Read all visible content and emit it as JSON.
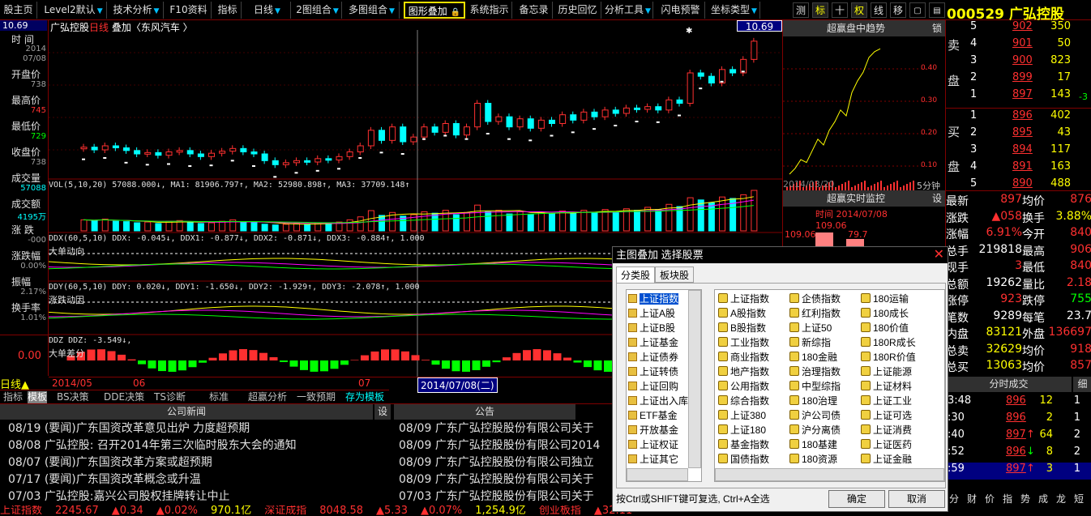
{
  "menu": {
    "items": [
      {
        "label": "股主页",
        "arrow": false
      },
      {
        "label": "Level2默认",
        "arrow": true
      },
      {
        "label": "技术分析",
        "arrow": true
      },
      {
        "label": "F10资料",
        "arrow": false
      },
      {
        "label": "指标",
        "arrow": false
      },
      {
        "label": "日线",
        "arrow": true
      },
      {
        "label": "2图组合",
        "arrow": true
      },
      {
        "label": "多图组合",
        "arrow": true
      },
      {
        "label": "图形叠加",
        "arrow": false
      },
      {
        "label": "系统指示",
        "arrow": false
      },
      {
        "label": "备忘录",
        "arrow": false
      },
      {
        "label": "历史回忆",
        "arrow": false
      },
      {
        "label": "分析工具",
        "arrow": true
      },
      {
        "label": "闪电预警",
        "arrow": false
      },
      {
        "label": "坐标类型",
        "arrow": true
      }
    ],
    "lock_icon": "lock-icon",
    "tools": [
      "测",
      "标",
      "十",
      "权",
      "线",
      "移"
    ],
    "stock_title": "000529 广弘控股"
  },
  "left_panel": {
    "price_top": "10.69",
    "time_label": "时 间",
    "time_value_1": "2014",
    "time_value_2": "07/08",
    "rows": [
      {
        "label": "开盘价",
        "value": "738"
      },
      {
        "label": "最高价",
        "value": "745"
      },
      {
        "label": "最低价",
        "value": "729"
      },
      {
        "label": "收盘价",
        "value": "738"
      },
      {
        "label": "成交量",
        "value": "57088"
      },
      {
        "label": "成交额",
        "value": "4195万"
      },
      {
        "label": "涨 跌",
        "value": "-000"
      },
      {
        "label": "涨跌幅",
        "value": "0.00%"
      },
      {
        "label": "振幅",
        "value": "2.17%"
      },
      {
        "label": "换手率",
        "value": "1.01%"
      }
    ],
    "ddz_value": "0.00",
    "period": "日线"
  },
  "chart": {
    "title_left": "广弘控股",
    "title_period": "日线",
    "title_overlay": "叠加〈东风汽车 〉",
    "price_right": "10.69",
    "vol_header": "VOL(5,10,20)  57088.000↓, MA1: 81906.797↑, MA2: 52980.898↑, MA3: 37709.148↑",
    "ddx_header": "DDX(60,5,10)  DDX: -0.045↓, DDX1: -0.877↓, DDX2: -0.871↓, DDX3: -0.884↑, 1.000",
    "ddx_label": "大单动向",
    "ddy_header": "DDY(60,5,10)  DDY: 0.020↓, DDY1: -1.650↓, DDY2: -1.929↑, DDY3: -2.078↑, 1.000",
    "ddy_label": "涨跌动因",
    "ddz_header": "DDZ  DDZ: -3.549↓,",
    "ddz_label": "大单差分",
    "date_axis": [
      "2014/05",
      "06",
      "07"
    ],
    "cursor_date": "2014/07/08(二)"
  },
  "chart_data": {
    "type": "candlestick",
    "title": "",
    "candles": [
      {
        "o": 7.38,
        "c": 7.4
      },
      {
        "o": 7.4,
        "c": 7.36
      },
      {
        "o": 7.36,
        "c": 7.42
      },
      {
        "o": 7.42,
        "c": 7.39
      },
      {
        "o": 7.39,
        "c": 7.35
      },
      {
        "o": 7.35,
        "c": 7.3
      },
      {
        "o": 7.3,
        "c": 7.32
      },
      {
        "o": 7.32,
        "c": 7.28
      },
      {
        "o": 7.28,
        "c": 7.33
      },
      {
        "o": 7.33,
        "c": 7.35
      },
      {
        "o": 7.35,
        "c": 7.3
      },
      {
        "o": 7.3,
        "c": 7.26
      },
      {
        "o": 7.26,
        "c": 7.31
      },
      {
        "o": 7.31,
        "c": 7.34
      },
      {
        "o": 7.34,
        "c": 7.38
      },
      {
        "o": 7.38,
        "c": 7.33
      },
      {
        "o": 7.33,
        "c": 7.3
      },
      {
        "o": 7.3,
        "c": 7.2
      },
      {
        "o": 7.2,
        "c": 7.14
      },
      {
        "o": 7.14,
        "c": 7.17
      },
      {
        "o": 7.17,
        "c": 7.2
      },
      {
        "o": 7.2,
        "c": 7.18
      },
      {
        "o": 7.18,
        "c": 7.23
      },
      {
        "o": 7.23,
        "c": 7.21
      },
      {
        "o": 7.21,
        "c": 7.26
      },
      {
        "o": 7.26,
        "c": 7.33
      },
      {
        "o": 7.33,
        "c": 7.42
      },
      {
        "o": 7.42,
        "c": 7.65
      },
      {
        "o": 7.65,
        "c": 7.5
      },
      {
        "o": 7.5,
        "c": 7.7
      },
      {
        "o": 7.7,
        "c": 7.48
      },
      {
        "o": 7.48,
        "c": 7.55
      },
      {
        "o": 7.55,
        "c": 7.7
      },
      {
        "o": 7.7,
        "c": 7.62
      },
      {
        "o": 7.62,
        "c": 7.75
      },
      {
        "o": 7.75,
        "c": 7.58
      },
      {
        "o": 7.58,
        "c": 7.7
      },
      {
        "o": 7.7,
        "c": 8.05
      },
      {
        "o": 8.05,
        "c": 7.78
      },
      {
        "o": 7.78,
        "c": 7.85
      },
      {
        "o": 7.85,
        "c": 7.7
      },
      {
        "o": 7.7,
        "c": 7.82
      },
      {
        "o": 7.82,
        "c": 7.68
      },
      {
        "o": 7.68,
        "c": 7.8
      },
      {
        "o": 7.8,
        "c": 7.75
      },
      {
        "o": 7.75,
        "c": 7.88
      },
      {
        "o": 7.88,
        "c": 7.8
      },
      {
        "o": 7.8,
        "c": 7.92
      },
      {
        "o": 7.92,
        "c": 7.85
      },
      {
        "o": 7.85,
        "c": 7.95
      },
      {
        "o": 7.95,
        "c": 7.9
      },
      {
        "o": 7.9,
        "c": 7.98
      },
      {
        "o": 7.98,
        "c": 7.96
      },
      {
        "o": 7.96,
        "c": 8.0
      },
      {
        "o": 8.0,
        "c": 7.95
      },
      {
        "o": 7.95,
        "c": 8.1
      },
      {
        "o": 8.1,
        "c": 8.05
      },
      {
        "o": 8.05,
        "c": 8.5
      },
      {
        "o": 8.5,
        "c": 8.45
      },
      {
        "o": 8.45,
        "c": 8.35
      },
      {
        "o": 8.35,
        "c": 8.55
      },
      {
        "o": 8.55,
        "c": 8.5
      },
      {
        "o": 8.5,
        "c": 8.7
      },
      {
        "o": 8.7,
        "c": 8.97
      }
    ],
    "volume": [
      30,
      28,
      32,
      26,
      25,
      22,
      24,
      20,
      26,
      28,
      24,
      20,
      22,
      26,
      30,
      24,
      22,
      18,
      16,
      18,
      20,
      18,
      22,
      20,
      24,
      30,
      38,
      55,
      42,
      50,
      40,
      44,
      52,
      48,
      56,
      44,
      50,
      70,
      52,
      56,
      46,
      52,
      44,
      50,
      46,
      54,
      48,
      56,
      50,
      58,
      52,
      60,
      56,
      64,
      58,
      72,
      66,
      90,
      84,
      76,
      92,
      88,
      98,
      110
    ],
    "intraday_series": [
      0.0,
      0.02,
      0.05,
      0.04,
      0.08,
      0.12,
      0.1,
      0.15,
      0.18,
      0.22,
      0.2,
      0.28,
      0.32,
      0.35,
      0.4,
      0.42,
      0.43
    ],
    "monitor_bars": [
      {
        "time": "109.06",
        "color": "#ff8080"
      },
      {
        "time": "79.7",
        "color": "#ff8080"
      }
    ]
  },
  "mini": {
    "trend_title": "超赢盘中趋势",
    "lock": "锁",
    "trend_date": "2014/03/20",
    "trend_period": "5分钟",
    "trend_axis": [
      "0.40",
      "0.30",
      "0.20",
      "0.10"
    ],
    "monitor_title": "超赢实时监控",
    "monitor_set": "设",
    "monitor_time": "时间  2014/07/08",
    "monitor_v1": "109.06",
    "monitor_v2": "79.7",
    "monitor_left": "109.06"
  },
  "orderbook": {
    "sell_label_1": "卖",
    "sell_label_2": "盘",
    "buy_label_1": "买",
    "buy_label_2": "盘",
    "rows": [
      {
        "n": "5",
        "p": "902",
        "v": "350"
      },
      {
        "n": "4",
        "p": "901",
        "v": "50"
      },
      {
        "n": "3",
        "p": "900",
        "v": "823"
      },
      {
        "n": "2",
        "p": "899",
        "v": "17"
      },
      {
        "n": "1",
        "p": "897",
        "v": "143"
      },
      {
        "n": "1",
        "p": "896",
        "v": "402"
      },
      {
        "n": "2",
        "p": "895",
        "v": "43"
      },
      {
        "n": "3",
        "p": "894",
        "v": "117"
      },
      {
        "n": "4",
        "p": "891",
        "v": "163"
      },
      {
        "n": "5",
        "p": "890",
        "v": "488"
      }
    ],
    "side_value": "-3"
  },
  "stats": {
    "rows": [
      {
        "l": "最新",
        "v": "897",
        "l2": "均价",
        "v2": "876"
      },
      {
        "l": "涨跌",
        "v": "▲058",
        "l2": "换手",
        "v2": "3.88%"
      },
      {
        "l": "涨幅",
        "v": "6.91%",
        "l2": "今开",
        "v2": "840"
      },
      {
        "l": "总手",
        "v": "219818",
        "l2": "最高",
        "v2": "906"
      },
      {
        "l": "现手",
        "v": "3",
        "l2": "最低",
        "v2": "840"
      },
      {
        "l": "总额",
        "v": "19262",
        "l2": "量比",
        "v2": "2.18"
      },
      {
        "l": "涨停",
        "v": "923",
        "l2": "跌停",
        "v2": "755"
      },
      {
        "l": "笔数",
        "v": "9289",
        "l2": "每笔",
        "v2": "23.7"
      },
      {
        "l": "内盘",
        "v": "83121",
        "l2": "外盘",
        "v2": "136697"
      },
      {
        "l": "总卖",
        "v": "32629",
        "l2": "均价",
        "v2": "918"
      },
      {
        "l": "总买",
        "v": "13063",
        "l2": "均价",
        "v2": "857"
      }
    ]
  },
  "fenshi": {
    "title": "分时成交",
    "tab": "细",
    "rows": [
      {
        "t": "3:48",
        "p": "896",
        "arrow": "",
        "v": "12",
        "n": "1"
      },
      {
        "t": ":30",
        "p": "896",
        "arrow": "",
        "v": "2",
        "n": "1"
      },
      {
        "t": ":40",
        "p": "897",
        "arrow": "↑",
        "v": "64",
        "n": "2"
      },
      {
        "t": ":52",
        "p": "896",
        "arrow": "↓",
        "v": "8",
        "n": "2"
      },
      {
        "t": ":59",
        "p": "897",
        "arrow": "↑",
        "v": "3",
        "n": "1"
      }
    ],
    "bottom_tabs": [
      "分",
      "财",
      "价",
      "指",
      "势",
      "成",
      "龙",
      "短"
    ]
  },
  "tabs": {
    "items": [
      "指标",
      "模板",
      "BS决策",
      "DDE决策",
      "TS诊断",
      "标准",
      "超赢分析",
      "一致预期",
      "存为模板"
    ]
  },
  "news": {
    "left_title": "公司新闻",
    "right_title": "公告",
    "set": "设",
    "left": [
      {
        "date": "08/19",
        "text": "(要闻)广东国资改革意见出炉 力度超预期"
      },
      {
        "date": "08/08",
        "text": "广弘控股: 召开2014年第三次临时股东大会的通知"
      },
      {
        "date": "08/07",
        "text": "(要闻)广东国资改革方案或超预期"
      },
      {
        "date": "07/17",
        "text": "(要闻)广东国资改革概念或升温"
      },
      {
        "date": "07/03",
        "text": "广弘控股:嘉兴公司股权挂牌转让中止"
      }
    ],
    "right": [
      {
        "date": "08/09",
        "text": "广东广弘控股股份有限公司关于"
      },
      {
        "date": "08/09",
        "text": "广东广弘控股股份有限公司2014"
      },
      {
        "date": "08/09",
        "text": "广东广弘控股股份有限公司独立"
      },
      {
        "date": "08/09",
        "text": "广东广弘控股股份有限公司关于"
      },
      {
        "date": "07/03",
        "text": "广东广弘控股股份有限公司关于"
      }
    ]
  },
  "ticker": {
    "items": [
      {
        "text": "上证指数",
        "color": "#ff3030"
      },
      {
        "text": "2245.67",
        "color": "#ff3030"
      },
      {
        "text": "▲0.34",
        "color": "#ff3030"
      },
      {
        "text": "▲0.02%",
        "color": "#ff3030"
      },
      {
        "text": "970.1亿",
        "color": "#ffff00"
      },
      {
        "text": "深证成指",
        "color": "#ff3030"
      },
      {
        "text": "8048.58",
        "color": "#ff3030"
      },
      {
        "text": "▲5.33",
        "color": "#ff3030"
      },
      {
        "text": "▲0.07%",
        "color": "#ff3030"
      },
      {
        "text": "1,254.9亿",
        "color": "#ffff00"
      },
      {
        "text": "创业板指",
        "color": "#ff3030"
      },
      {
        "text": "▲32.11",
        "color": "#ff3030"
      }
    ]
  },
  "dialog": {
    "title": "主图叠加  选择股票",
    "tab1": "分类股",
    "tab2": "板块股",
    "tree": [
      "上证指数",
      "上证A股",
      "上证B股",
      "上证基金",
      "上证债券",
      "上证转债",
      "上证回购",
      "上证出入库",
      "ETF基金",
      "开放基金",
      "上证权证",
      "上证其它"
    ],
    "grid_col1": [
      "上证指数",
      "A股指数",
      "B股指数",
      "工业指数",
      "商业指数",
      "地产指数",
      "公用指数",
      "综合指数",
      "上证380",
      "上证180",
      "基金指数",
      "国债指数"
    ],
    "grid_col2": [
      "企债指数",
      "红利指数",
      "上证50",
      "新综指",
      "180金融",
      "治理指数",
      "中型综指",
      "180治理",
      "沪公司债",
      "沪分离债",
      "180基建",
      "180资源"
    ],
    "grid_col3": [
      "180运输",
      "180成长",
      "180价值",
      "180R成长",
      "180R价值",
      "上证能源",
      "上证材料",
      "上证工业",
      "上证可选",
      "上证消费",
      "上证医药",
      "上证金融"
    ],
    "hint": "按Ctrl或SHIFT键可复选, Ctrl+A全选",
    "ok": "确定",
    "cancel": "取消"
  }
}
